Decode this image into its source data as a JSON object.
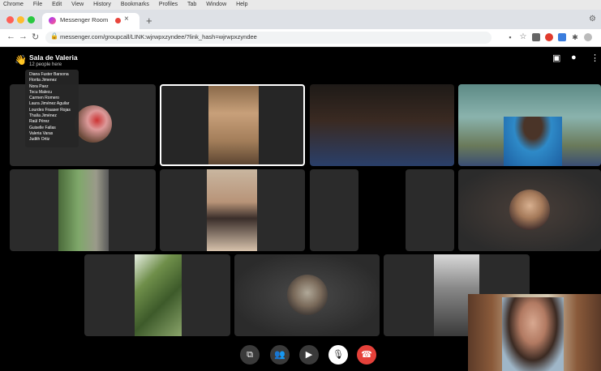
{
  "menubar": {
    "items": [
      "Chrome",
      "File",
      "Edit",
      "View",
      "History",
      "Bookmarks",
      "Profiles",
      "Tab",
      "Window",
      "Help"
    ]
  },
  "browser": {
    "tab_title": "Messenger Room",
    "url": "messenger.com/groupcall/LINK:wjrwpxzyndee/?link_hash=wjrwpxzyndee",
    "new_tab_symbol": "+",
    "close_symbol": "×"
  },
  "room": {
    "title": "Sala de Valeria",
    "subtitle": "12 people here",
    "emoji": "👋",
    "participants": [
      "Diana Fuster Barsona",
      "Florita Jimenez",
      "Nora Paez",
      "Tocu Malecu",
      "Carmen Romero",
      "Laura Jiménez Aguilar",
      "Lourdes Fraaser Rojas",
      "Thalía Jiménez",
      "Raúl Pérez",
      "Guiselle Fallas",
      "Valeria Varas",
      "Judith Ortiz"
    ]
  },
  "controls": [
    "screen-share-icon",
    "people-icon",
    "video-camera-icon",
    "microphone-muted-icon",
    "end-call-icon"
  ],
  "colors": {
    "app_bg": "#000000",
    "tile_bg": "#2b2b2b",
    "end_call": "#e5413a",
    "active_tile_border": "#ffffff"
  }
}
